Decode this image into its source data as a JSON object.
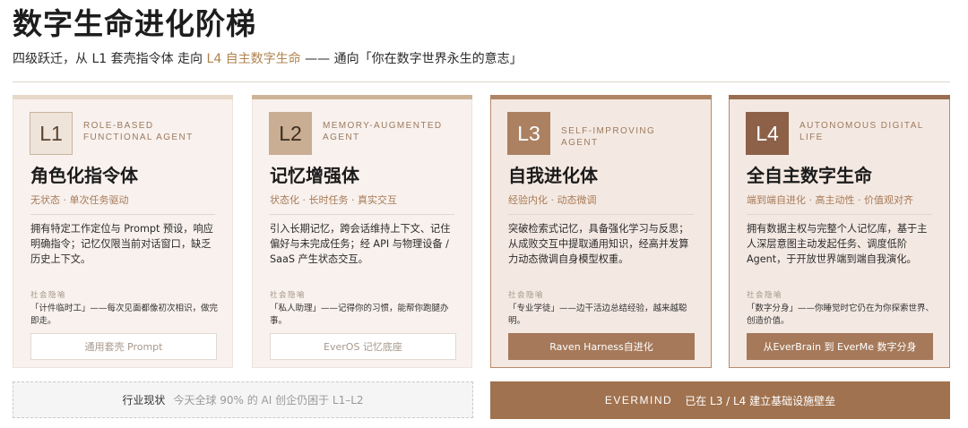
{
  "header": {
    "title": "数字生命进化阶梯",
    "subtitle_pre": "四级跃迁，从 L1 套壳指令体 走向 ",
    "subtitle_hl": "L4 自主数字生命",
    "subtitle_post": " —— 通向「你在数字世界永生的意志」"
  },
  "levels": [
    {
      "badge": "L1",
      "en": "ROLE-BASED FUNCTIONAL AGENT",
      "name": "角色化指令体",
      "tagline": "无状态 · 单次任务驱动",
      "description": "拥有特定工作定位与 Prompt 预设，响应明确指令；记忆仅限当前对话窗口，缺乏历史上下文。",
      "metaphor_label": "社会隐喻",
      "metaphor": "「计件临时工」——每次见面都像初次相识，做完即走。",
      "cta": "通用套壳 Prompt"
    },
    {
      "badge": "L2",
      "en": "MEMORY-AUGMENTED AGENT",
      "name": "记忆增强体",
      "tagline": "状态化 · 长时任务 · 真实交互",
      "description": "引入长期记忆，跨会话维持上下文、记住偏好与未完成任务；经 API 与物理设备 / SaaS 产生状态交互。",
      "metaphor_label": "社会隐喻",
      "metaphor": "「私人助理」——记得你的习惯，能帮你跑腿办事。",
      "cta": "EverOS 记忆底座"
    },
    {
      "badge": "L3",
      "en": "SELF-IMPROVING AGENT",
      "name": "自我进化体",
      "tagline": "经验内化 · 动态微调",
      "description": "突破检索式记忆，具备强化学习与反思；从成败交互中提取通用知识，经高并发算力动态微调自身模型权重。",
      "metaphor_label": "社会隐喻",
      "metaphor": "「专业学徒」——边干活边总结经验，越来越聪明。",
      "cta": "Raven Harness自进化"
    },
    {
      "badge": "L4",
      "en": "AUTONOMOUS DIGITAL LIFE",
      "name": "全自主数字生命",
      "tagline": "端到端自进化 · 高主动性 · 价值观对齐",
      "description": "拥有数据主权与完整个人记忆库，基于主人深层意图主动发起任务、调度低阶 Agent，于开放世界端到端自我演化。",
      "metaphor_label": "社会隐喻",
      "metaphor": "「数字分身」——你睡觉时它仍在为你探索世界、创造价值。",
      "cta": "从EverBrain 到 EverMe 数字分身"
    }
  ],
  "footer": {
    "industry_label": "行业现状",
    "industry_text": "今天全球 90% 的 AI 创企仍困于 L1–L2",
    "evermind_label": "EVERMIND",
    "evermind_text": "已在 L3 / L4 建立基础设施壁垒"
  }
}
